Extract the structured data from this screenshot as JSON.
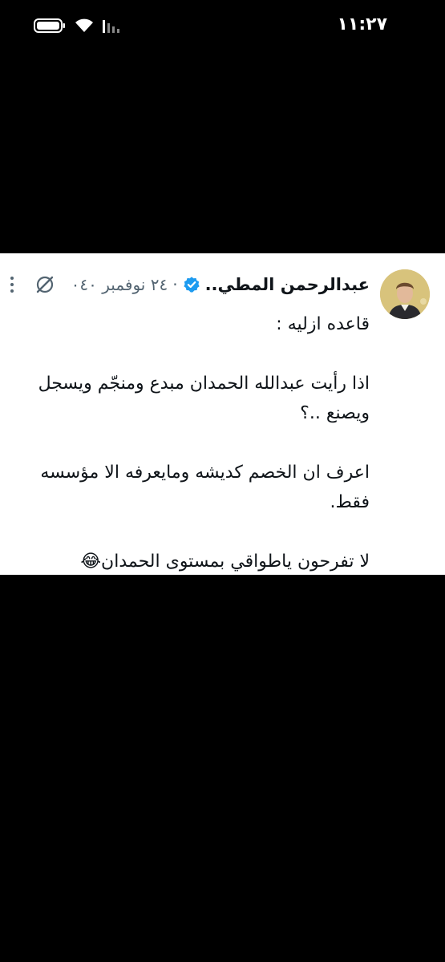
{
  "status_bar": {
    "time": "١١:٢٧",
    "icons": [
      "battery-icon",
      "wifi-icon",
      "signal-icon"
    ]
  },
  "tweet": {
    "author_name": "عبدالرحمن المطي..",
    "verified": true,
    "separator": "·",
    "timestamp": "٢٤ نوفمبر ٠٤٠",
    "lines": [
      "قاعده ازليه :",
      "",
      "اذا رأيت عبدالله الحمدان مبدع ومنجّم ويسجل",
      "ويصنع ..؟",
      "",
      "اعرف ان الخصم كديشه ومايعرفه الا مؤسسه",
      "فقط.",
      "",
      "لا تفرحون ياطواقي بمستوى الحمدان😂"
    ]
  },
  "colors": {
    "background": "#000000",
    "card": "#ffffff",
    "text": "#0f1419",
    "muted": "#536471",
    "verified": "#1d9bf0"
  }
}
